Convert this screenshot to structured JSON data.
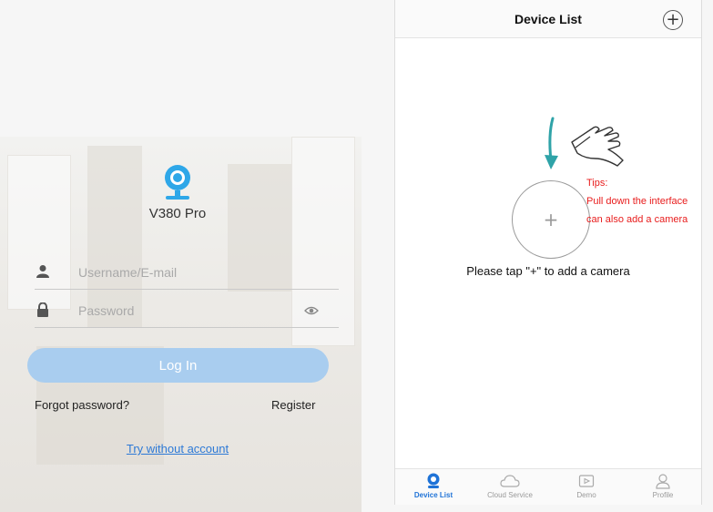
{
  "login": {
    "app_name": "V380 Pro",
    "username_placeholder": "Username/E-mail",
    "password_placeholder": "Password",
    "login_label": "Log In",
    "forgot_label": "Forgot password?",
    "register_label": "Register",
    "try_label": "Try without account",
    "colors": {
      "button": "#a9cdef",
      "link": "#2d79d6",
      "logo": "#2ea7e8"
    }
  },
  "device_list": {
    "title": "Device List",
    "add_glyph": "+",
    "tips_title": "Tips:",
    "tips_line1": "Pull down the interface",
    "tips_line2": "can also add a camera",
    "hint": "Please tap \"+\"  to add a camera",
    "colors": {
      "tips": "#e81c1c",
      "arrow": "#2fa3a8",
      "active_tab": "#1f73d7"
    }
  },
  "tabs": [
    {
      "label": "Device List",
      "icon": "camera-icon",
      "active": true
    },
    {
      "label": "Cloud Service",
      "icon": "cloud-icon",
      "active": false
    },
    {
      "label": "Demo",
      "icon": "play-icon",
      "active": false
    },
    {
      "label": "Profile",
      "icon": "profile-icon",
      "active": false
    }
  ]
}
